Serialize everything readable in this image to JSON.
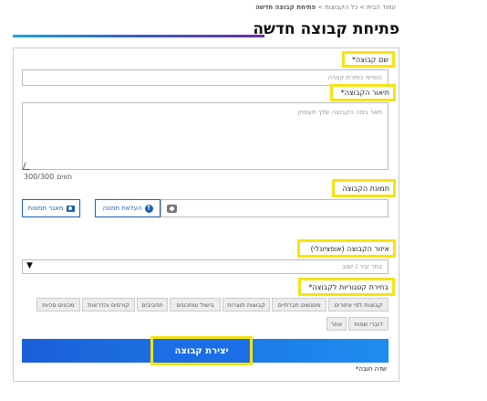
{
  "breadcrumb": {
    "home": "עמוד הבית",
    "groups": "כל הקבוצות",
    "current": "פתיחת קבוצה חדשה",
    "sep": ">"
  },
  "page_title": "פתיחת קבוצה חדשה",
  "fields": {
    "name": {
      "label": "שם קבוצה*",
      "placeholder": "הוסיפי כותרת קצרה"
    },
    "description": {
      "label": "תיאור הקבוצה*",
      "placeholder": "תאר במה הקבוצה שלך תעסוק",
      "counter": "300/300",
      "counter_suffix": "תווים"
    },
    "image": {
      "label": "תמונת הקבוצה",
      "upload_label": "העלאת תמונה",
      "gallery_label": "מאגר תמונות"
    },
    "region": {
      "label": "איזור הקבוצה (אופציונלי)",
      "placeholder": "בחר עיר / ישוב",
      "arrow": "▼"
    },
    "categories": {
      "label": "בחירת קטגוריות לקבוצה*",
      "row1": [
        "קבוצות לפי איזורים",
        "מפגשים חברתיים",
        "קבוצות תוצרות",
        "בישול ומתכונים",
        "תחביבים",
        "קורסים והדראות",
        "מכונים סכיות"
      ],
      "row2": [
        "דוברי שפות",
        "אחר"
      ]
    }
  },
  "submit_label": "יצירת קבוצה",
  "required_note": "שדה חובה*",
  "colors": {
    "highlight": "#f6e40f",
    "primary": "#1b6ee6",
    "outline": "#1b5fb4"
  }
}
